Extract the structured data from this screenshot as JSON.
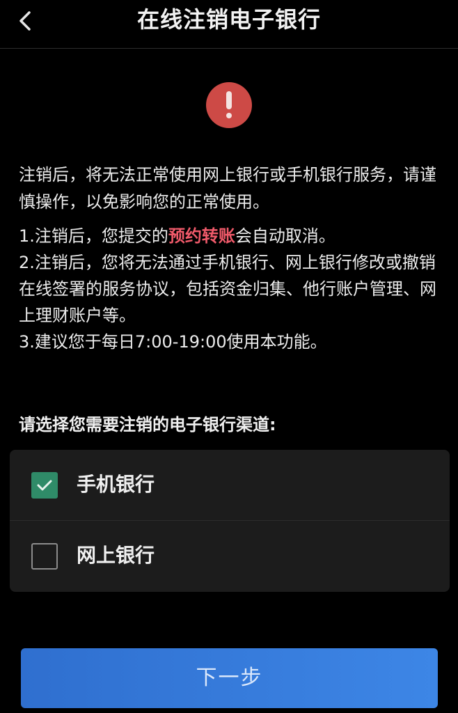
{
  "header": {
    "title": "在线注销电子银行",
    "back_icon": "chevron-left-icon"
  },
  "alert": {
    "icon": "exclamation-icon",
    "color": "#cd4a46"
  },
  "intro_text": "注销后，将无法正常使用网上银行或手机银行服务，请谨慎操作，以免影响您的正常使用。",
  "notes": {
    "item1_prefix": "1.注销后，您提交的",
    "item1_highlight": "预约转账",
    "item1_suffix": "会自动取消。",
    "item2": "2.注销后，您将无法通过手机银行、网上银行修改或撤销在线签署的服务协议，包括资金归集、他行账户管理、网上理财账户等。",
    "item3": "3.建议您于每日7:00-19:00使用本功能。",
    "highlight_color": "#f05a6a"
  },
  "channel_section": {
    "label": "请选择您需要注销的电子银行渠道:",
    "options": [
      {
        "label": "手机银行",
        "checked": true
      },
      {
        "label": "网上银行",
        "checked": false
      }
    ],
    "checked_color": "#2f8b68"
  },
  "next_button": {
    "label": "下一步",
    "color": "#3a7fe0"
  }
}
